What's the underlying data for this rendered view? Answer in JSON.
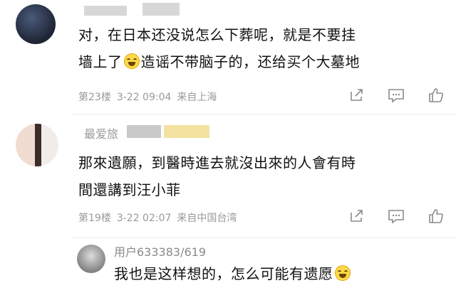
{
  "comments": [
    {
      "text_line1": "对，在日本还没说怎么下葬呢，就是不要挂",
      "text_line2_a": "墙上了",
      "text_line2_b": "造谣不带脑子的，还给买个大墓地",
      "floor": "第23楼",
      "time": "3-22 09:04",
      "location": "来自上海"
    },
    {
      "username": "最爱旅",
      "text_line1": "那來遺願，到醫時進去就沒出來的人會有時",
      "text_line2": "間還講到汪小菲",
      "floor": "第19楼",
      "time": "3-22 02:07",
      "location": "来自中国台湾"
    },
    {
      "username": "用户633383/619",
      "text_line1": "我也是这样想的，怎么可能有遗愿"
    }
  ],
  "icons": [
    "share-icon",
    "reply-icon",
    "like-icon"
  ],
  "colors": {
    "meta": "#999999",
    "icon": "#8a8a8a",
    "divider": "#eaeaea"
  }
}
